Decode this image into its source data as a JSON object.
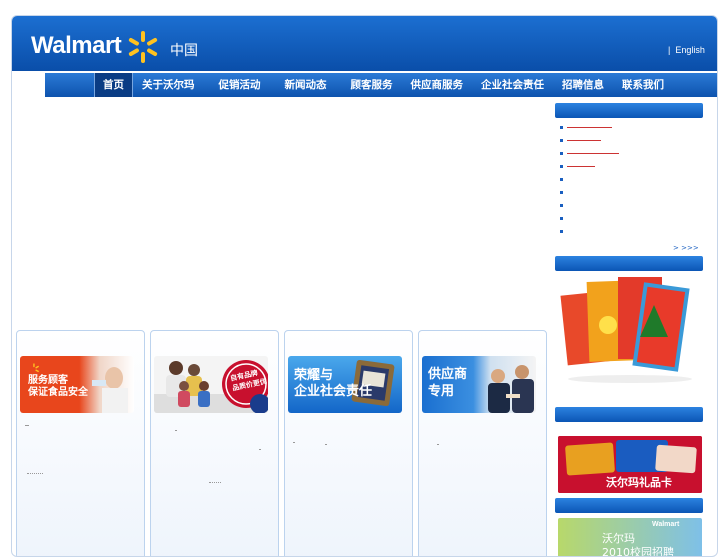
{
  "header": {
    "logo_text": "Walmart",
    "logo_suffix": "中国",
    "lang_separator": "|",
    "lang_link": "English"
  },
  "nav": {
    "items": [
      "首页",
      "关于沃尔玛",
      "促销活动",
      "新闻动态",
      "顾客服务",
      "供应商服务",
      "企业社会责任",
      "招聘信息",
      "联系我们"
    ]
  },
  "cards": [
    {
      "banner_line1": "服务顾客",
      "banner_line2": "保证食品安全"
    },
    {
      "banner_line1": "自有品牌",
      "banner_line2": "品质价更优"
    },
    {
      "banner_line1": "荣耀与",
      "banner_line2": "企业社会责任"
    },
    {
      "banner_line1": "供应商",
      "banner_line2": "专用"
    }
  ],
  "sidebar": {
    "more_label": ">    >>>",
    "giftcard_label": "沃尔玛礼品卡",
    "recruit_brand": "Walmart",
    "recruit_line1": "沃尔玛",
    "recruit_line2": "2010校园招聘"
  },
  "colors": {
    "brand_blue": "#0a4ea9",
    "nav_active": "#0a3c84",
    "spark_yellow": "#ffc220"
  }
}
